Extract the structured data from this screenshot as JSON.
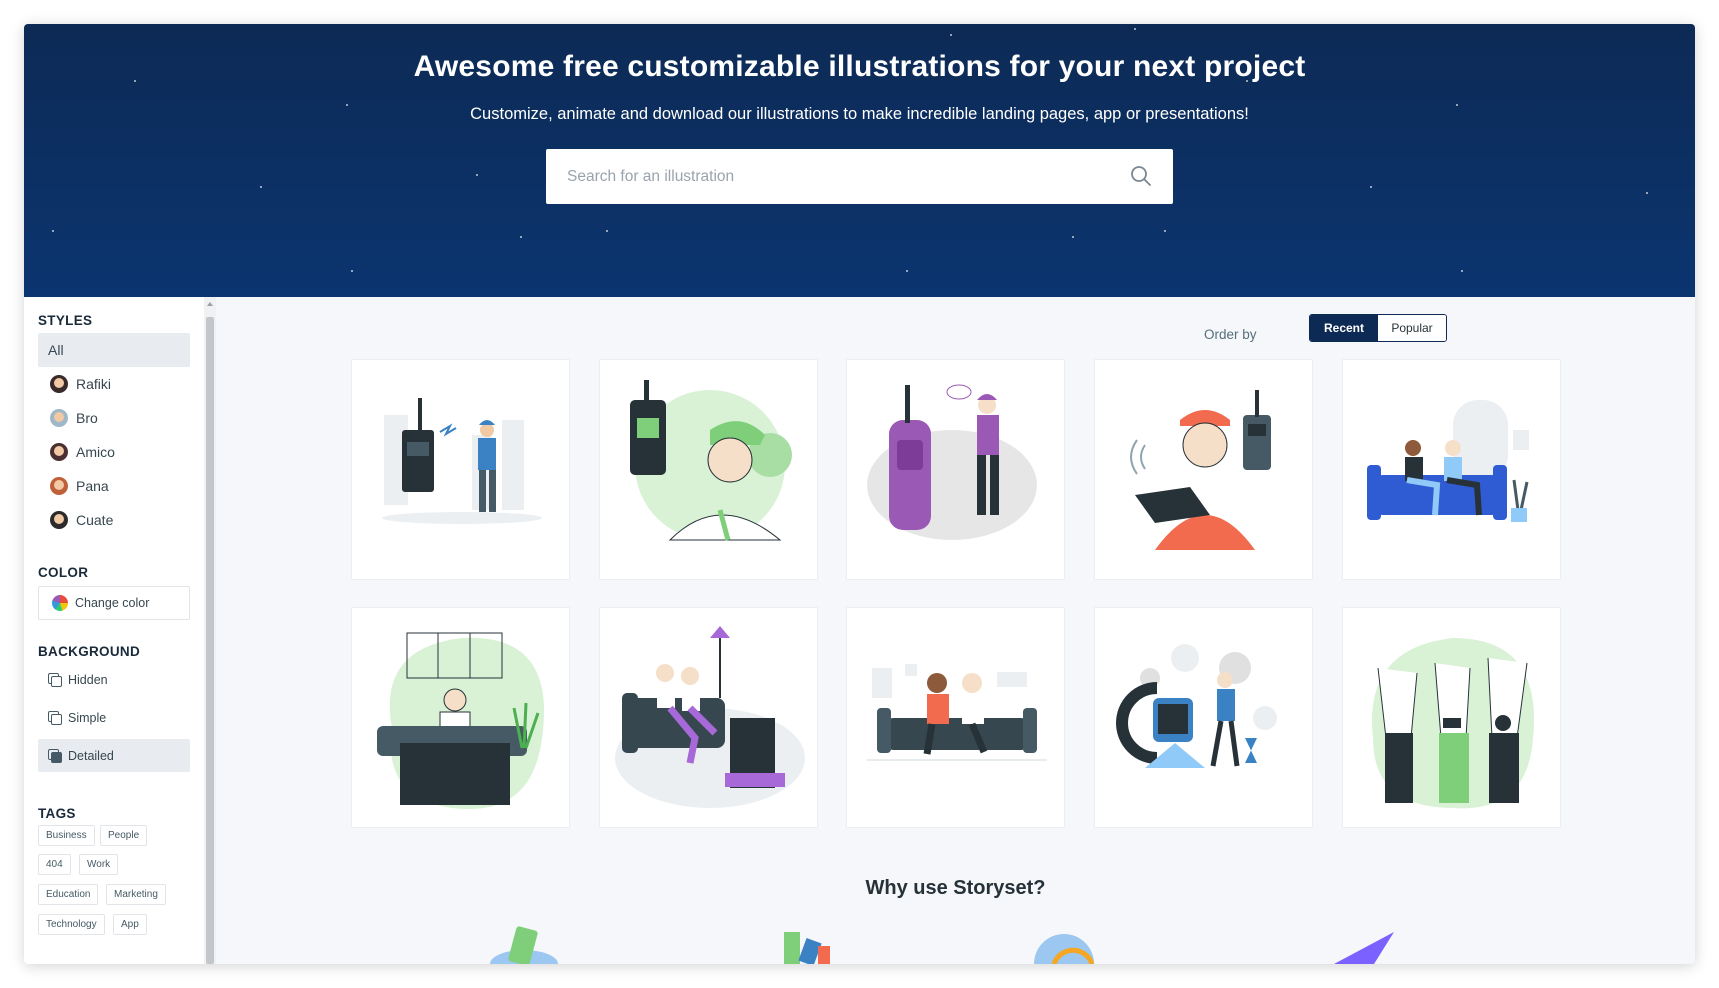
{
  "hero": {
    "title": "Awesome free customizable illustrations for your next project",
    "subtitle": "Customize, animate and download our illustrations to make incredible landing pages, app or presentations!",
    "search_placeholder": "Search for an illustration"
  },
  "sidebar": {
    "styles_title": "STYLES",
    "styles": [
      {
        "label": "All",
        "active": true
      },
      {
        "label": "Rafiki",
        "icon": "rafiki-avatar-icon"
      },
      {
        "label": "Bro",
        "icon": "bro-avatar-icon"
      },
      {
        "label": "Amico",
        "icon": "amico-avatar-icon"
      },
      {
        "label": "Pana",
        "icon": "pana-avatar-icon"
      },
      {
        "label": "Cuate",
        "icon": "cuate-avatar-icon"
      }
    ],
    "color_title": "COLOR",
    "change_color_label": "Change color",
    "background_title": "BACKGROUND",
    "backgrounds": [
      {
        "label": "Hidden"
      },
      {
        "label": "Simple"
      },
      {
        "label": "Detailed",
        "active": true
      }
    ],
    "tags_title": "TAGS",
    "tags": [
      "Business",
      "People",
      "404",
      "Work",
      "Education",
      "Marketing",
      "Technology",
      "App"
    ]
  },
  "order": {
    "label": "Order by",
    "options": [
      "Recent",
      "Popular"
    ],
    "selected": "Recent"
  },
  "illustrations": [
    {
      "subject": "walkie-talkie-city",
      "accent": "#3b82c4"
    },
    {
      "subject": "walkie-talkie-man",
      "accent": "#7fcf7a"
    },
    {
      "subject": "walkie-talkie-purple",
      "accent": "#9b59b6"
    },
    {
      "subject": "walkie-talkie-clipboard",
      "accent": "#f26b4f"
    },
    {
      "subject": "couple-blue-sofa",
      "accent": "#2f5bd3"
    },
    {
      "subject": "man-watching-tv",
      "accent": "#7fcf7a"
    },
    {
      "subject": "couple-purple-sofa",
      "accent": "#a768d8"
    },
    {
      "subject": "couple-on-couch",
      "accent": "#f26b4f"
    },
    {
      "subject": "smartwatch-man",
      "accent": "#3b82c4"
    },
    {
      "subject": "hands-watches",
      "accent": "#7fcf7a"
    }
  ],
  "why_title": "Why use Storyset?",
  "colors": {
    "hero": "#0d2a55",
    "accent": "#0d2a55"
  }
}
